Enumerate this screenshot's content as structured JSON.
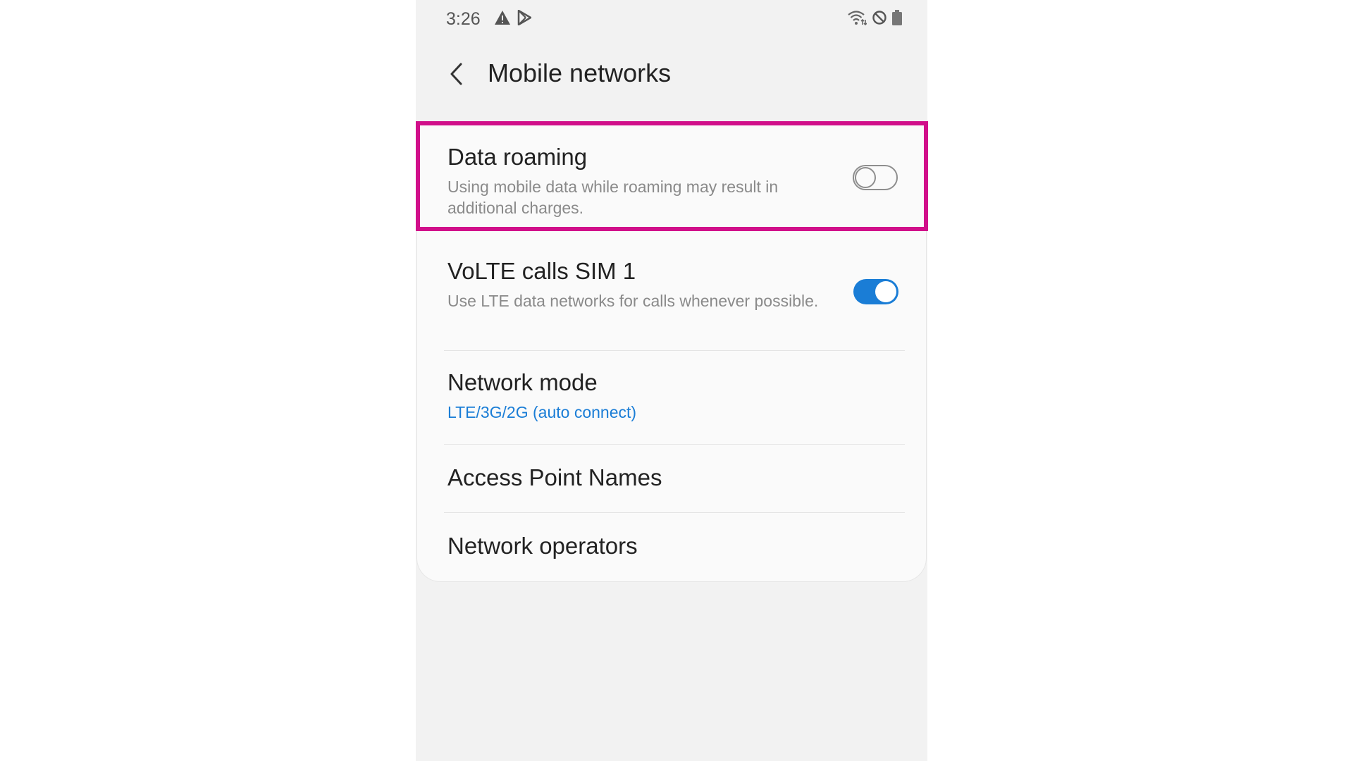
{
  "status_bar": {
    "time": "3:26",
    "left_icons": [
      "warning-icon",
      "play-store-icon"
    ],
    "right_icons": [
      "wifi-icon",
      "do-not-disturb-icon",
      "battery-icon"
    ]
  },
  "header": {
    "back_icon": "chevron-left-icon",
    "title": "Mobile networks"
  },
  "settings": [
    {
      "title": "Data roaming",
      "subtitle": "Using mobile data while roaming may result in additional charges.",
      "toggle": "off"
    },
    {
      "title": "VoLTE calls SIM 1",
      "subtitle": "Use LTE data networks for calls whenever possible.",
      "toggle": "on"
    },
    {
      "title": "Network mode",
      "subtitle": "LTE/3G/2G (auto connect)"
    },
    {
      "title": "Access Point Names"
    },
    {
      "title": "Network operators"
    }
  ],
  "colors": {
    "accent": "#1a7dd6",
    "highlight": "#d10f8a",
    "background": "#f2f2f2",
    "card": "#fafafa"
  }
}
